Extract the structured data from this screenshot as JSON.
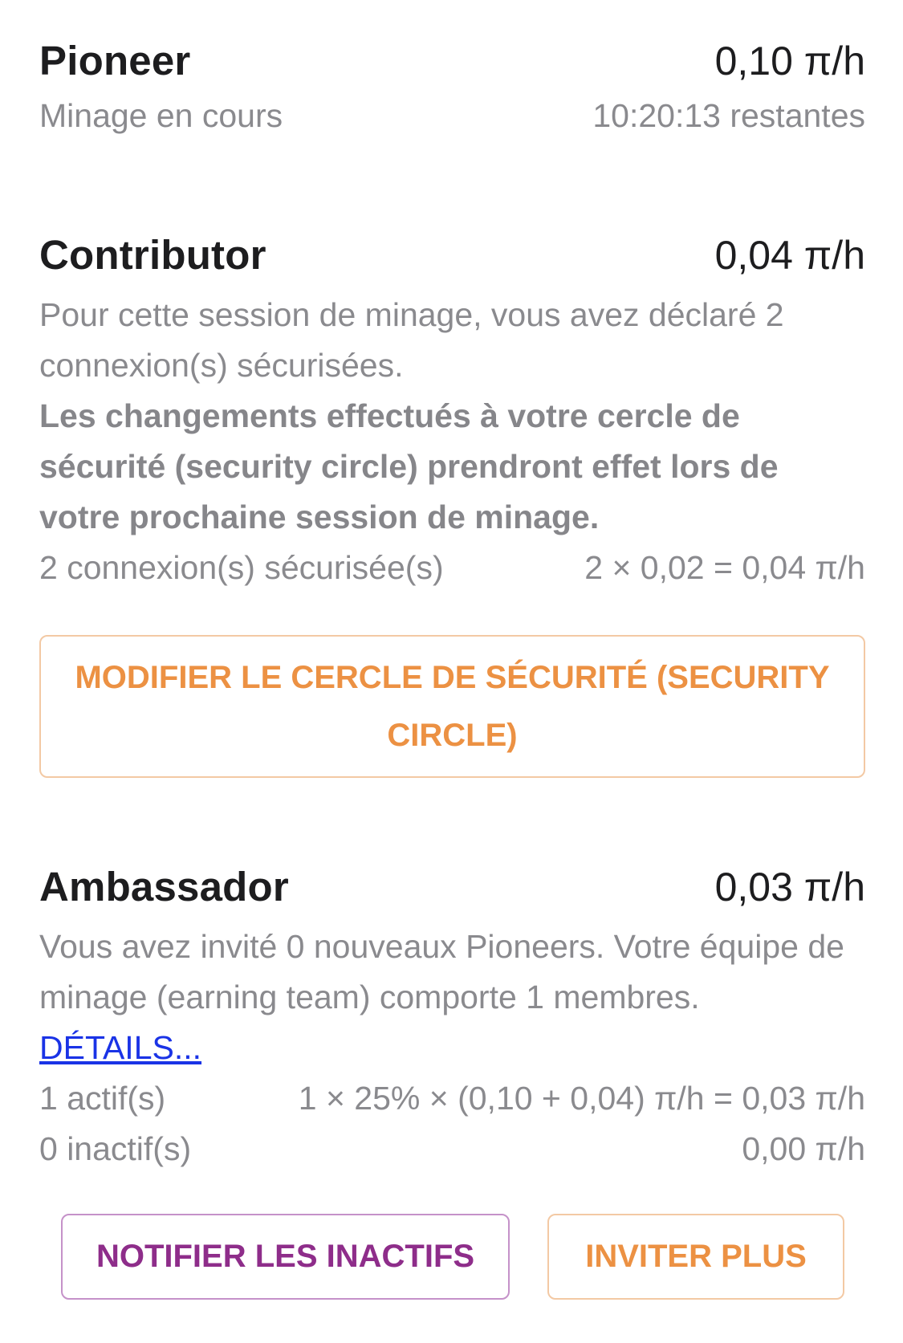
{
  "pioneer": {
    "title": "Pioneer",
    "rate": "0,10 π/h",
    "status": "Minage en cours",
    "remaining": "10:20:13 restantes"
  },
  "contributor": {
    "title": "Contributor",
    "rate": "0,04 π/h",
    "description": "Pour cette session de minage, vous avez déclaré 2 connexion(s) sécurisées.",
    "notice": "Les changements effectués à votre cercle de sécurité (security circle) prendront effet lors de votre prochaine session de minage.",
    "connections_label": "2 connexion(s) sécurisée(s)",
    "connections_formula": "2 × 0,02 = 0,04 π/h",
    "modify_button": "MODIFIER LE CERCLE DE SÉCURITÉ (SECURITY CIRCLE)"
  },
  "ambassador": {
    "title": "Ambassador",
    "rate": "0,03 π/h",
    "description": "Vous avez invité 0 nouveaux Pioneers. Votre équipe de minage (earning team) comporte 1 membres.",
    "details_link": "DÉTAILS...",
    "active_label": "1 actif(s)",
    "active_formula": "1 × 25% × (0,10 + 0,04) π/h = 0,03 π/h",
    "inactive_label": "0 inactif(s)",
    "inactive_value": "0,00 π/h",
    "notify_button": "NOTIFIER LES INACTIFS",
    "invite_button": "INVITER PLUS"
  },
  "colors": {
    "accent_orange": "#ec9143",
    "accent_purple": "#8e2d8a",
    "link_blue": "#1a33e6",
    "muted_gray": "#8a8a8e"
  }
}
